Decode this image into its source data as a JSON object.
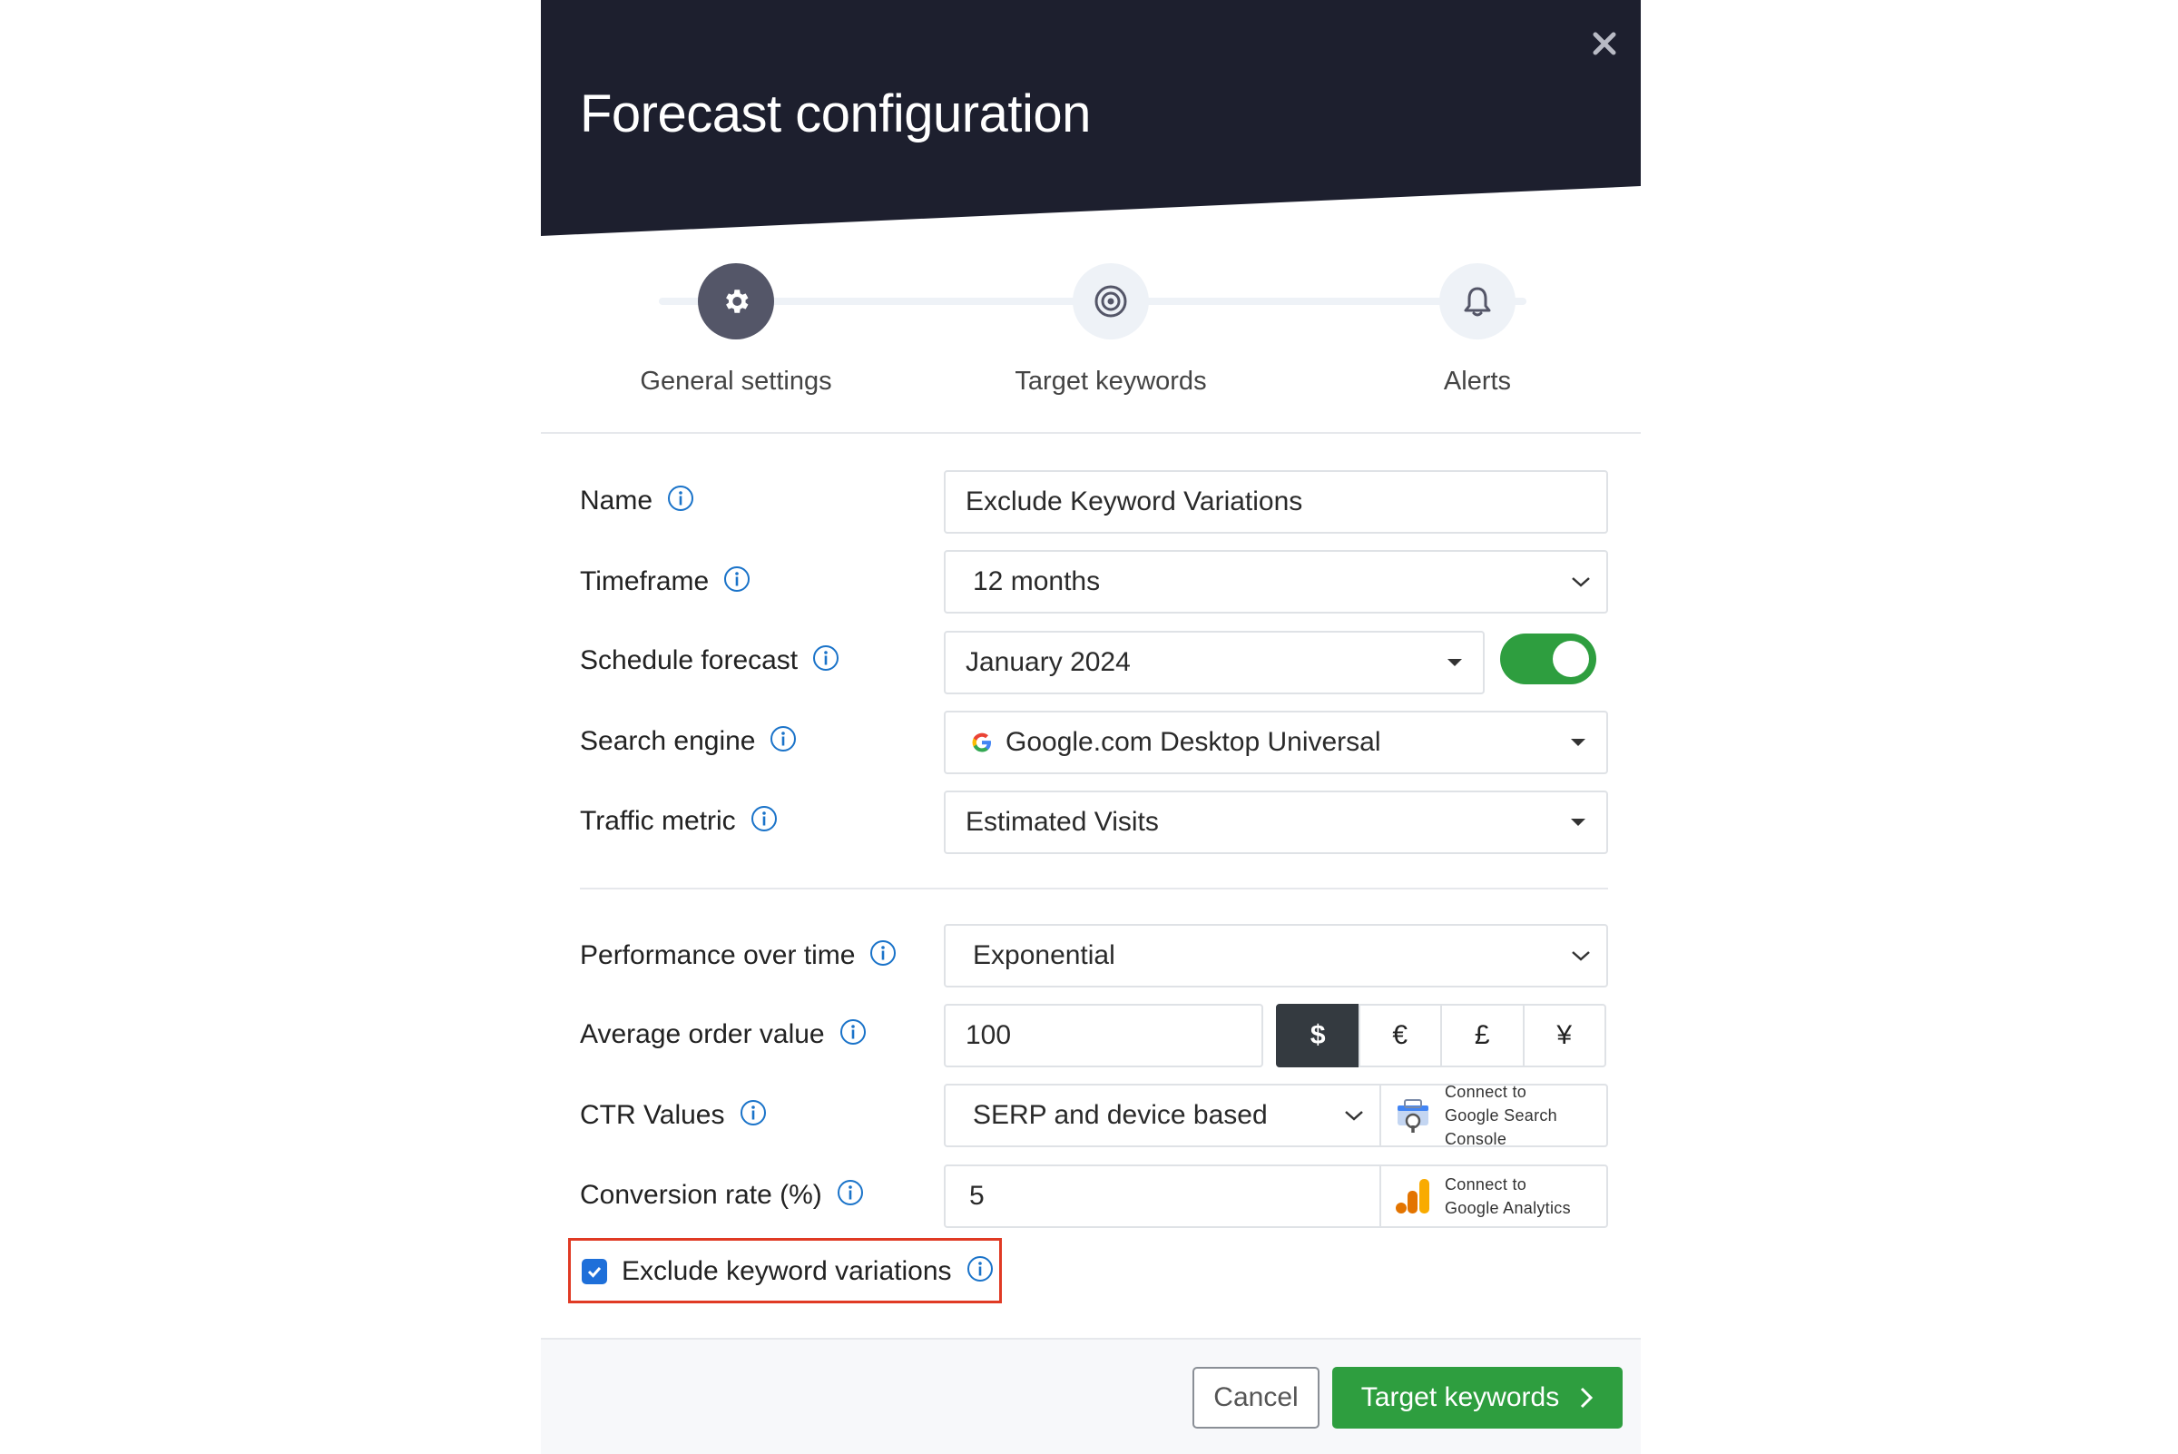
{
  "modal": {
    "title": "Forecast configuration",
    "close_icon": "close-icon"
  },
  "stepper": {
    "steps": [
      {
        "label": "General settings",
        "icon": "gear-icon",
        "state": "active"
      },
      {
        "label": "Target keywords",
        "icon": "target-icon",
        "state": "inactive"
      },
      {
        "label": "Alerts",
        "icon": "bell-icon",
        "state": "inactive"
      }
    ]
  },
  "form": {
    "name": {
      "label": "Name",
      "value": "Exclude Keyword Variations"
    },
    "timeframe": {
      "label": "Timeframe",
      "value": "12 months"
    },
    "schedule": {
      "label": "Schedule forecast",
      "value": "January 2024",
      "enabled": true
    },
    "engine": {
      "label": "Search engine",
      "value": "Google.com Desktop Universal",
      "icon": "google-icon"
    },
    "traffic": {
      "label": "Traffic metric",
      "value": "Estimated Visits"
    },
    "performance": {
      "label": "Performance over time",
      "value": "Exponential"
    },
    "aov": {
      "label": "Average order value",
      "value": "100",
      "currencies": [
        "$",
        "€",
        "£",
        "¥"
      ],
      "selected_currency": "$"
    },
    "ctr": {
      "label": "CTR Values",
      "value": "SERP and device based",
      "connect_lines": [
        "Connect to",
        "Google Search",
        "Console"
      ]
    },
    "conversion": {
      "label": "Conversion rate (%)",
      "value": "5",
      "connect_lines": [
        "Connect to",
        "Google Analytics"
      ]
    },
    "exclude": {
      "label": "Exclude keyword variations",
      "checked": true
    }
  },
  "footer": {
    "cancel_label": "Cancel",
    "next_label": "Target keywords"
  },
  "colors": {
    "header_bg": "#1d1f2e",
    "primary_green": "#2e9e3f",
    "checkbox_blue": "#1e6fd9",
    "info_blue": "#1a73c9",
    "highlight_red": "#e03a24"
  }
}
